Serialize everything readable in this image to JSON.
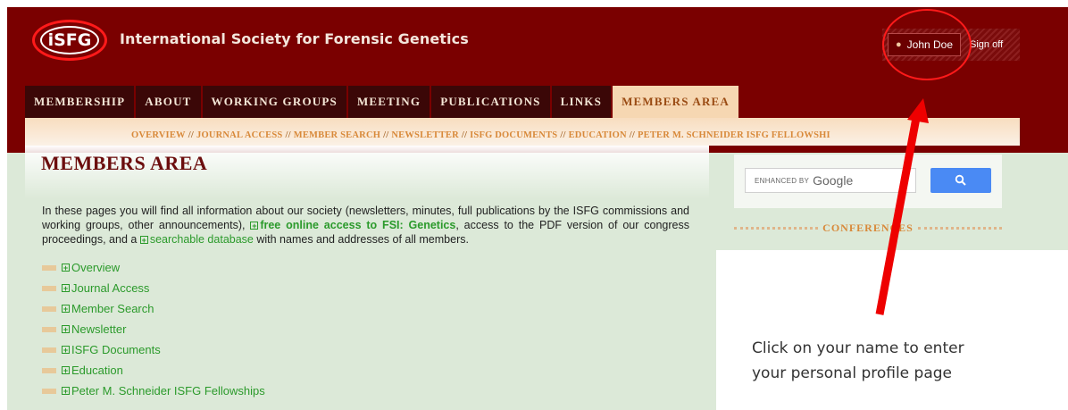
{
  "header": {
    "logo_text": "iSFG",
    "site_title": "International Society for Forensic Genetics",
    "user_name": "John Doe",
    "sign_off": "Sign off"
  },
  "nav": {
    "tabs": [
      "MEMBERSHIP",
      "ABOUT",
      "WORKING GROUPS",
      "MEETING",
      "PUBLICATIONS",
      "LINKS",
      "MEMBERS AREA"
    ],
    "active": "MEMBERS AREA"
  },
  "subnav": {
    "items": [
      "OVERVIEW",
      "JOURNAL ACCESS",
      "MEMBER SEARCH",
      "NEWSLETTER",
      "ISFG DOCUMENTS",
      "EDUCATION",
      "PETER M. SCHNEIDER ISFG FELLOWSHI"
    ],
    "separator": "//"
  },
  "main": {
    "title": "MEMBERS AREA",
    "intro_1": "In these pages you will find all information about our society (newsletters, minutes, full publications by the ISFG commissions and working groups, other announcements), ",
    "intro_link_1": "free online access to FSI: Genetics",
    "intro_2": ", access to the PDF version of our congress proceedings, and a ",
    "intro_link_2": "searchable database",
    "intro_3": " with names and addresses of all members.",
    "list": [
      "Overview",
      "Journal Access",
      "Member Search",
      "Newsletter",
      "ISFG Documents",
      "Education",
      "Peter M. Schneider ISFG Fellowships"
    ]
  },
  "sidebar": {
    "search_enhanced": "ENHANCED BY",
    "search_google": "Google",
    "conferences": "CONFERENCES"
  },
  "annotation": {
    "line_1": "Click on your name to enter",
    "line_2": "your personal profile page"
  },
  "icons": {
    "user": "user-icon",
    "search": "search-icon",
    "expand": "plus-box-icon"
  },
  "colors": {
    "header_bg": "#7a0000",
    "accent_orange": "#d8893a",
    "link_green": "#2b9a2b",
    "annotation_red": "#ff1a1a"
  }
}
